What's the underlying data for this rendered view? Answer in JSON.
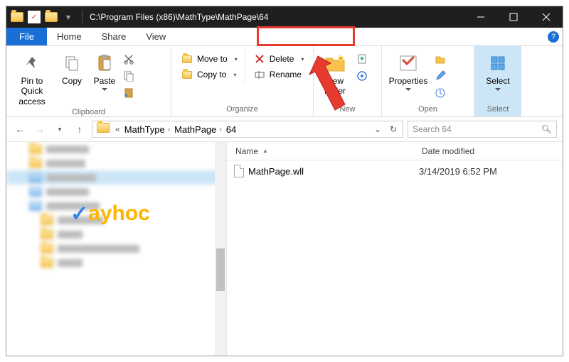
{
  "window": {
    "title": "C:\\Program Files (x86)\\MathType\\MathPage\\64"
  },
  "ribbon": {
    "file": "File",
    "tabs": {
      "home": "Home",
      "share": "Share",
      "view": "View"
    },
    "clipboard": {
      "label": "Clipboard",
      "pin": "Pin to Quick access",
      "copy": "Copy",
      "paste": "Paste"
    },
    "organize": {
      "label": "Organize",
      "move": "Move to",
      "copy": "Copy to",
      "delete": "Delete",
      "rename": "Rename"
    },
    "newgrp": {
      "label": "New",
      "folder": "New folder"
    },
    "opengrp": {
      "label": "Open",
      "properties": "Properties"
    },
    "selectgrp": {
      "label": "Select",
      "select": "Select"
    }
  },
  "breadcrumbs": [
    "MathType",
    "MathPage",
    "64"
  ],
  "search": {
    "placeholder": "Search 64"
  },
  "columns": {
    "name": "Name",
    "date": "Date modified"
  },
  "files": [
    {
      "name": "MathPage.wll",
      "date": "3/14/2019 6:52 PM"
    }
  ],
  "watermark": {
    "text1": "ayhoc"
  }
}
